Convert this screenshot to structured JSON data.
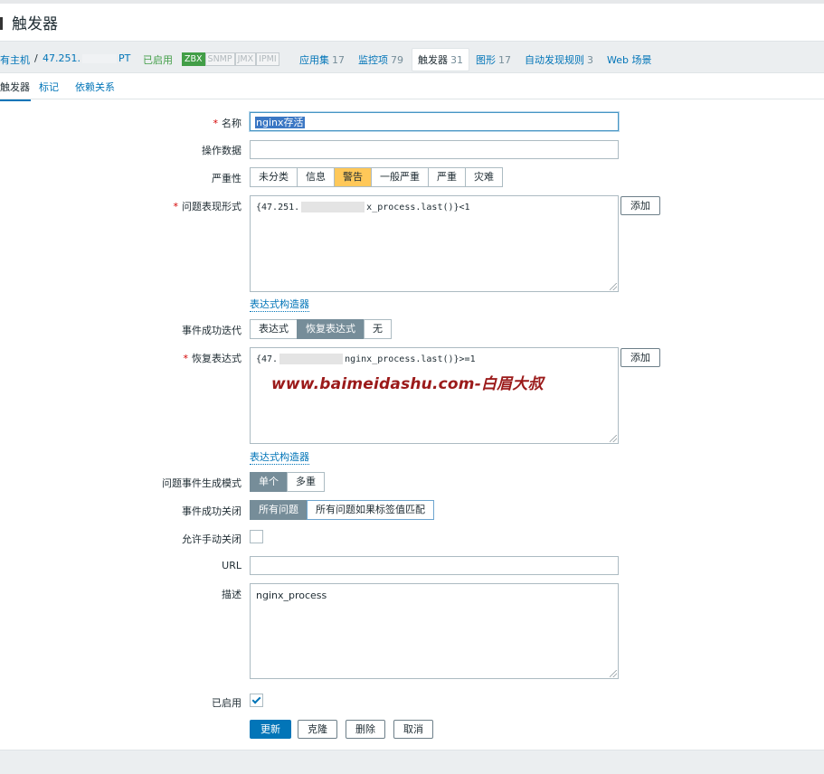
{
  "page": {
    "title": "触发器"
  },
  "breadcrumb": {
    "all_hosts": "有主机",
    "separator": "/",
    "host": "47.251.",
    "host_suffix": "PT",
    "status": "已启用",
    "interfaces": [
      "ZBX",
      "SNMP",
      "JMX",
      "IPMI"
    ],
    "items": [
      {
        "label": "应用集",
        "count": "17"
      },
      {
        "label": "监控项",
        "count": "79"
      },
      {
        "label": "触发器",
        "count": "31"
      },
      {
        "label": "图形",
        "count": "17"
      },
      {
        "label": "自动发现规则",
        "count": "3"
      },
      {
        "label": "Web 场景",
        "count": ""
      }
    ]
  },
  "tabs": [
    "触发器",
    "标记",
    "依赖关系"
  ],
  "form": {
    "name_label": "名称",
    "name_value": "nginx存活",
    "opdata_label": "操作数据",
    "opdata_value": "",
    "severity_label": "严重性",
    "severity_options": [
      "未分类",
      "信息",
      "警告",
      "一般严重",
      "严重",
      "灾难"
    ],
    "severity_selected": "警告",
    "problem_expr_label": "问题表现形式",
    "problem_expr_prefix": "{47.251.",
    "problem_expr_suffix": "x_process.last()}<1",
    "add_label": "添加",
    "expr_builder": "表达式构造器",
    "ok_event_label": "事件成功迭代",
    "ok_event_options": [
      "表达式",
      "恢复表达式",
      "无"
    ],
    "ok_event_selected": "恢复表达式",
    "recovery_label": "恢复表达式",
    "recovery_prefix": "{47.",
    "recovery_suffix": "nginx_process.last()}>=1",
    "watermark": "www.baimeidashu.com-白眉大叔",
    "gen_mode_label": "问题事件生成模式",
    "gen_mode_options": [
      "单个",
      "多重"
    ],
    "gen_mode_selected": "单个",
    "ok_close_label": "事件成功关闭",
    "ok_close_options": [
      "所有问题",
      "所有问题如果标签值匹配"
    ],
    "ok_close_selected": "所有问题",
    "manual_close_label": "允许手动关闭",
    "manual_close_checked": false,
    "url_label": "URL",
    "url_value": "",
    "desc_label": "描述",
    "desc_value": "nginx_process",
    "enabled_label": "已启用",
    "enabled_checked": true
  },
  "actions": {
    "update": "更新",
    "clone": "克隆",
    "delete": "删除",
    "cancel": "取消"
  }
}
